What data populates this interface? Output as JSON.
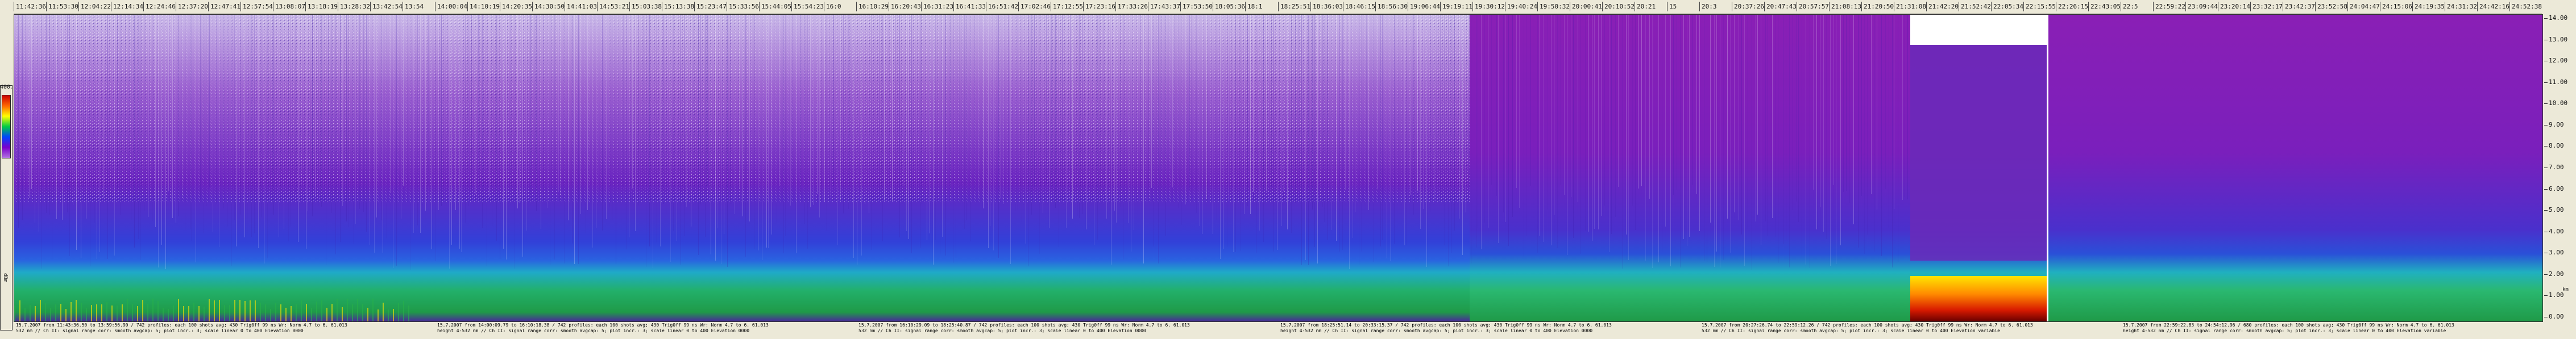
{
  "time_axis": {
    "ticks": [
      "11:42:36",
      "11:53:30",
      "12:04:22",
      "12:14:34",
      "12:24:46",
      "12:37:20",
      "12:47:41",
      "12:57:54",
      "13:08:07",
      "13:18:19",
      "13:28:32",
      "13:42:54",
      "13:54",
      "14:00:04",
      "14:10:19",
      "14:20:35",
      "14:30:50",
      "14:41:03",
      "14:53:21",
      "15:03:38",
      "15:13:38",
      "15:23:47",
      "15:33:56",
      "15:44:05",
      "15:54:23",
      "16:0",
      "16:10:29",
      "16:20:43",
      "16:31:23",
      "16:41:33",
      "16:51:42",
      "17:02:46",
      "17:12:55",
      "17:23:16",
      "17:33:26",
      "17:43:37",
      "17:53:50",
      "18:05:36",
      "18:1",
      "18:25:51",
      "18:36:03",
      "18:46:15",
      "18:56:30",
      "19:06:44",
      "19:19:11",
      "19:30:12",
      "19:40:24",
      "19:50:32",
      "20:00:41",
      "20:10:52",
      "20:21",
      "15",
      "20:3",
      "20:37:26",
      "20:47:43",
      "20:57:57",
      "21:08:13",
      "21:20:50",
      "21:31:08",
      "21:42:20",
      "21:52:42",
      "22:05:34",
      "22:15:55",
      "22:26:15",
      "22:43:05",
      "22:5",
      "22:59:22",
      "23:09:44",
      "23:20:14",
      "23:32:17",
      "23:42:37",
      "23:52:58",
      "24:04:47",
      "24:15:06",
      "24:19:35",
      "24:31:32",
      "24:42:16",
      "24:52:38"
    ]
  },
  "colorbar": {
    "max_label": "400.0",
    "unit_label": "dBm"
  },
  "height_axis": {
    "ticks": [
      "14.00",
      "13.00",
      "12.00",
      "11.00",
      "10.00",
      "9.00",
      "8.00",
      "7.00",
      "6.00",
      "5.00",
      "4.00",
      "3.00",
      "2.00",
      "1.00",
      "0.00"
    ],
    "unit": "km"
  },
  "segments": [
    {
      "line1": "15.7.2007 from 11:43:36.50 to 13:59:56.90 / 742 profiles: each 100 shots avg; 430 Trig0ff 99 ns Wr: Norm 4.7 to 6. 61.013",
      "line2": "532 nm // Ch II: signal range corr: smooth avgcap: 5; plot incr.: 3; scale linear 0 to 400 Elevation 0000"
    },
    {
      "line1": "15.7.2007 from 14:00:09.79 to 16:10:18.38 / 742 profiles: each 100 shots avg; 430 Trig0ff 99 ns Wr: Norm 4.7 to 6. 61.013",
      "line2": "height 4-532 nm // Ch II: signal range corr: smooth avgcap: 5; plot incr.: 3; scale linear 0 to 400 Elevation 0000"
    },
    {
      "line1": "15.7.2007 from 16:10:29.09 to 18:25:40.87 / 742 profiles: each 100 shots avg; 430 Trig0ff 99 ns Wr: Norm 4.7 to 6. 61.013",
      "line2": "532 nm // Ch II: signal range corr: smooth avgcap: 5; plot incr.: 3; scale linear 0 to 400 Elevation 0000"
    },
    {
      "line1": "15.7.2007 from 18:25:51.14 to 20:33:15.37 / 742 profiles: each 100 shots avg; 430 Trig0ff 99 ns Wr: Norm 4.7 to 6. 61.013",
      "line2": "height 4-532 nm // Ch II: signal range corr: smooth avgcap: 5; plot incr.: 3; scale linear 0 to 400 Elevation 0000"
    },
    {
      "line1": "15.7.2007 from 20:27:26.74 to 22:59:12.26 / 742 profiles: each 100 shots avg; 430 Trig0ff 99 ns Wr: Norm 4.7 to 6. 61.013",
      "line2": "532 nm // Ch II: signal range corr: smooth avgcap: 5; plot incr.: 3; scale linear 0 to 400 Elevation variable"
    },
    {
      "line1": "15.7.2007 from 22:59:22.83 to 24:54:12.96 / 680 profiles: each 100 shots avg; 430 Trig0ff 99 ns Wr: Norm 4.7 to 6. 61.013",
      "line2": "height 4-532 nm // Ch II: signal range corr: smooth avgcap: 5; plot incr.: 3; scale linear 0 to 400 Elevation variable"
    }
  ],
  "colors": {
    "background": "#ece9d8",
    "purple_high": "#8a1fb5",
    "blue_mid": "#2a4bd8",
    "cyan_layer": "#1fb4c8",
    "green_low": "#28b04a",
    "yellow_hot": "#ffe600",
    "red_hot": "#d81a00"
  }
}
